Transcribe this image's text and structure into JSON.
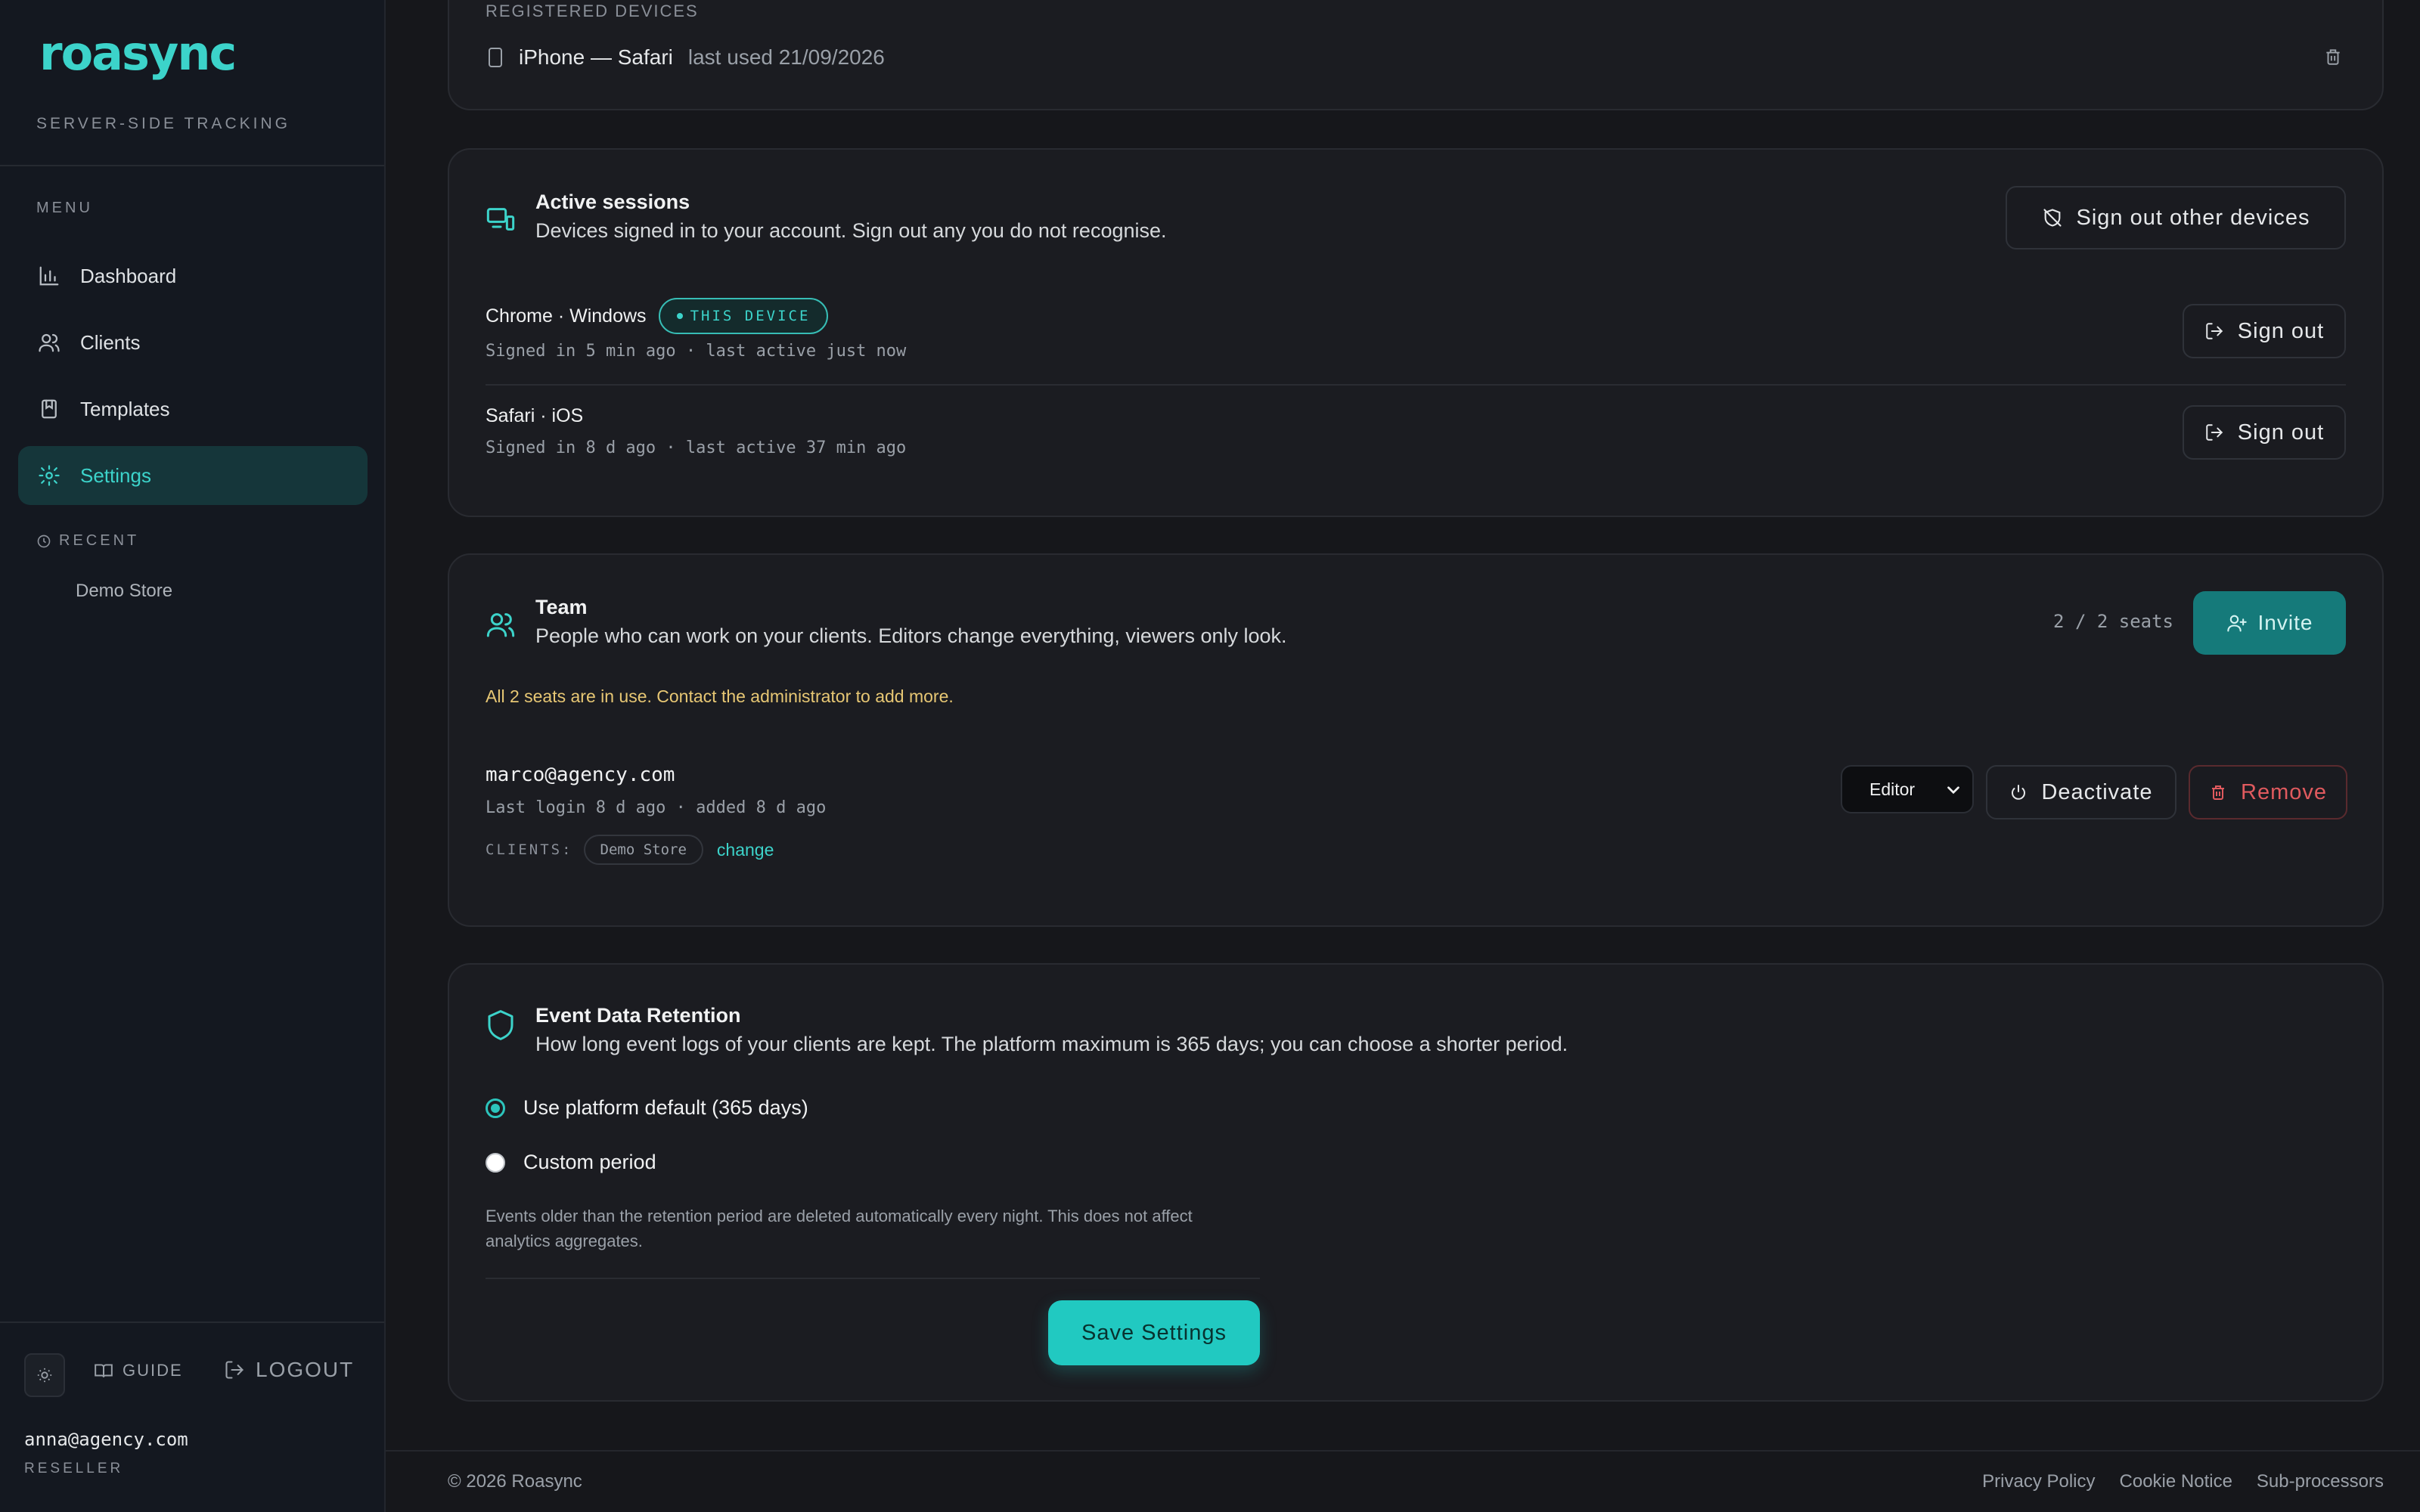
{
  "brand": {
    "logo": "roasync",
    "tagline": "SERVER-SIDE TRACKING",
    "accent": "#3cd3ca"
  },
  "sidebar": {
    "menu_heading": "MENU",
    "items": [
      {
        "label": "Dashboard",
        "icon": "chart-bar-icon",
        "active": false
      },
      {
        "label": "Clients",
        "icon": "users-icon",
        "active": false
      },
      {
        "label": "Templates",
        "icon": "book-icon",
        "active": false
      },
      {
        "label": "Settings",
        "icon": "gear-icon",
        "active": true
      }
    ],
    "recent_heading": "RECENT",
    "recent_items": [
      "Demo Store"
    ],
    "guide_label": "GUIDE",
    "logout_label": "LOGOUT",
    "user_email": "anna@agency.com",
    "user_role": "RESELLER"
  },
  "registered_devices": {
    "heading": "REGISTERED DEVICES",
    "device_name": "iPhone — Safari",
    "device_meta": "last used 21/09/2026"
  },
  "sessions": {
    "title": "Active sessions",
    "subtitle": "Devices signed in to your account. Sign out any you do not recognise.",
    "sign_out_others_label": "Sign out other devices",
    "list": [
      {
        "name": "Chrome · Windows",
        "badge": "THIS DEVICE",
        "meta": "Signed in 5 min ago · last active just now",
        "sign_out_label": "Sign out"
      },
      {
        "name": "Safari · iOS",
        "badge": "",
        "meta": "Signed in 8 d ago · last active 37 min ago",
        "sign_out_label": "Sign out"
      }
    ]
  },
  "team": {
    "title": "Team",
    "subtitle": "People who can work on your clients. Editors change everything, viewers only look.",
    "seats": "2 / 2 seats",
    "invite_label": "Invite",
    "warning": "All 2 seats are in use. Contact the administrator to add more.",
    "member": {
      "email": "marco@agency.com",
      "meta": "Last login 8 d ago · added 8 d ago",
      "clients_label": "CLIENTS:",
      "client_chip": "Demo Store",
      "change_label": "change",
      "role": "Editor",
      "deactivate_label": "Deactivate",
      "remove_label": "Remove"
    }
  },
  "retention": {
    "title": "Event Data Retention",
    "subtitle": "How long event logs of your clients are kept. The platform maximum is 365 days; you can choose a shorter period.",
    "option_default": "Use platform default (365 days)",
    "option_custom": "Custom period",
    "selected": "default",
    "note": "Events older than the retention period are deleted automatically every night. This does not affect analytics aggregates.",
    "save_label": "Save Settings"
  },
  "footer": {
    "copyright": "© 2026 Roasync",
    "links": [
      "Privacy Policy",
      "Cookie Notice",
      "Sub-processors"
    ]
  }
}
